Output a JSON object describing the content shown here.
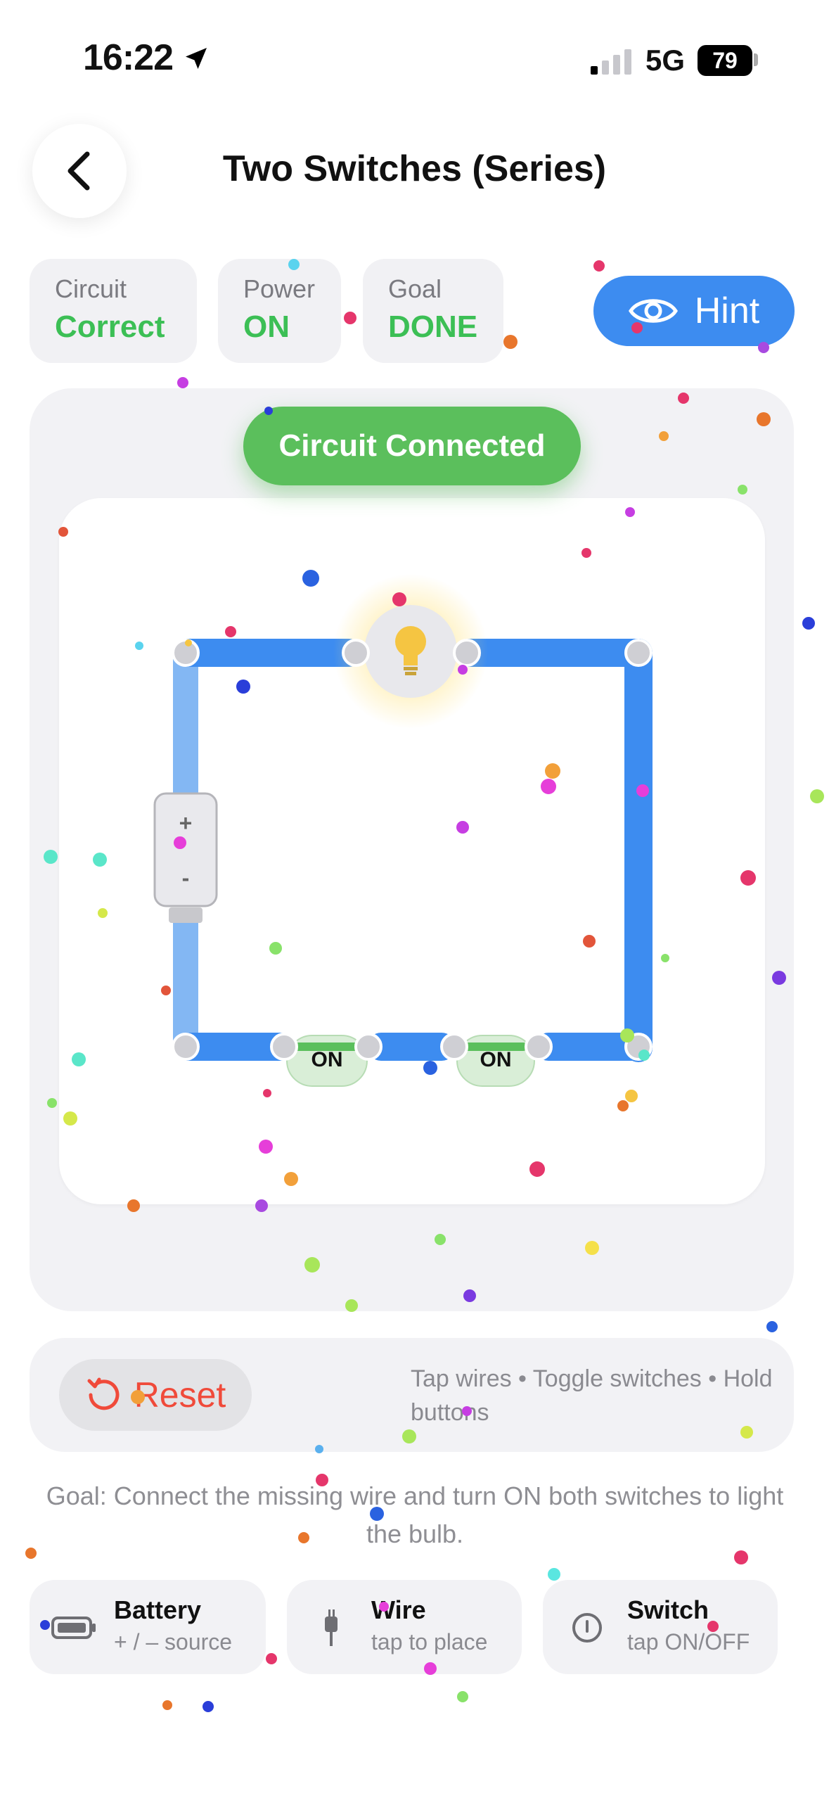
{
  "status": {
    "time": "16:22",
    "network": "5G",
    "battery": "79"
  },
  "header": {
    "title": "Two Switches (Series)"
  },
  "stats": [
    {
      "label": "Circuit",
      "value": "Correct"
    },
    {
      "label": "Power",
      "value": "ON"
    },
    {
      "label": "Goal",
      "value": "DONE"
    }
  ],
  "hint": {
    "label": "Hint"
  },
  "board": {
    "banner": "Circuit Connected",
    "battery_plus": "+",
    "battery_minus": "-",
    "switch1": "ON",
    "switch2": "ON"
  },
  "controls": {
    "reset_label": "Reset",
    "tips": "Tap wires • Toggle switches • Hold buttons"
  },
  "goal_text": "Goal: Connect the missing wire and turn ON both switches to light the bulb.",
  "tools": [
    {
      "name": "Battery",
      "sub": "+ / – source"
    },
    {
      "name": "Wire",
      "sub": "tap to place"
    },
    {
      "name": "Switch",
      "sub": "tap ON/OFF"
    }
  ],
  "colors": {
    "accent": "#3d8cf0",
    "success": "#5bbf5c",
    "danger": "#f04a3a",
    "wire": "#3d8cf0",
    "bulb": "#f5c542"
  }
}
